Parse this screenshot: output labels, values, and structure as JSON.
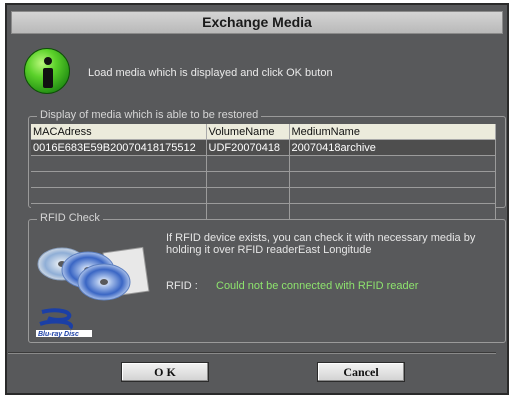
{
  "dialog": {
    "title": "Exchange Media",
    "instruction": "Load media which is displayed and click OK buton"
  },
  "restore_group": {
    "legend": "Display of media which is able to be restored",
    "columns": [
      "MACAdress",
      "VolumeName",
      "MediumName"
    ],
    "rows": [
      [
        "0016E683E59B20070418175512",
        "UDF20070418",
        "20070418archive"
      ],
      [
        "",
        "",
        ""
      ],
      [
        "",
        "",
        ""
      ],
      [
        "",
        "",
        ""
      ],
      [
        "",
        "",
        ""
      ]
    ]
  },
  "rfid_group": {
    "legend": "RFID Check",
    "description": "If RFID device exists, you can check it with necessary media by holding it over RFID readerEast Longitude",
    "status_label": "RFID :",
    "status_value": "Could not be connected with RFID reader"
  },
  "buttons": {
    "ok": "O K",
    "cancel": "Cancel"
  },
  "icons": {
    "info": "info-icon",
    "discs": "discs-image",
    "bluray": "bluray-logo"
  },
  "colors": {
    "dialog_bg": "#58595b",
    "status_error": "#8ee46e",
    "header_bg": "#ecebdc"
  }
}
